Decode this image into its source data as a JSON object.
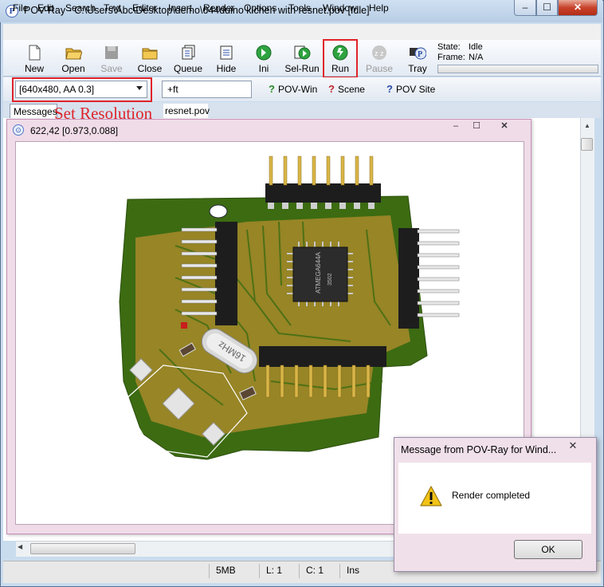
{
  "window": {
    "title": "POV-Ray - C:\\Users\\Abc\\Desktop\\demo\\644duino kichen with resnet.pov [Idle]",
    "app_icon_glyph": "P",
    "min_glyph": "–",
    "max_glyph": "☐",
    "close_glyph": "✕"
  },
  "menu": [
    "File",
    "Edit",
    "Search",
    "Text",
    "Editor",
    "Insert",
    "Render",
    "Options",
    "Tools",
    "Window",
    "Help"
  ],
  "toolbar": {
    "buttons": [
      {
        "label": "New",
        "icon": "new-file-icon",
        "enabled": true
      },
      {
        "label": "Open",
        "icon": "open-folder-icon",
        "enabled": true
      },
      {
        "label": "Save",
        "icon": "save-disk-icon",
        "enabled": false
      },
      {
        "label": "Close",
        "icon": "close-folder-icon",
        "enabled": true
      },
      {
        "label": "Queue",
        "icon": "queue-icon",
        "enabled": true
      },
      {
        "label": "Hide",
        "icon": "hide-icon",
        "enabled": true
      },
      {
        "label": "Ini",
        "icon": "ini-icon",
        "enabled": true
      },
      {
        "label": "Sel-Run",
        "icon": "sel-run-icon",
        "enabled": true
      },
      {
        "label": "Run",
        "icon": "run-icon",
        "enabled": true
      },
      {
        "label": "Pause",
        "icon": "pause-icon",
        "enabled": false
      },
      {
        "label": "Tray",
        "icon": "tray-icon",
        "enabled": true
      }
    ],
    "state_label": "State:",
    "state_value": "Idle",
    "frame_label": "Frame:",
    "frame_value": "N/A"
  },
  "toolbar2": {
    "resolution": "[640x480, AA 0.3]",
    "command_line": "+ft",
    "links": [
      {
        "label": "POV-Win",
        "icon": "help-green-icon",
        "color": "#2a8a2a"
      },
      {
        "label": "Scene",
        "icon": "help-red-icon",
        "color": "#c0282d"
      },
      {
        "label": "POV Site",
        "icon": "help-blue-icon",
        "color": "#2a4ea8"
      }
    ]
  },
  "tabs": {
    "messages": "Messages",
    "file": "resnet.pov"
  },
  "annotation": {
    "text": "Set Resolution",
    "color": "#e0232a"
  },
  "render_window": {
    "coords": "622,42 [0.973,0.088]",
    "min_glyph": "–",
    "max_glyph": "☐",
    "close_glyph": "✕",
    "chip_label": "ATMEGA644A",
    "chip_code": "3502",
    "crystal_label": "16MHz",
    "pcb_color": "#3c6b12",
    "trace_color": "#b89a2a"
  },
  "status_bar": {
    "memory": "5MB",
    "line": "L: 1",
    "column": "C: 1",
    "mode": "Ins"
  },
  "dialog": {
    "title": "Message from POV-Ray for Wind...",
    "close_glyph": "✕",
    "icon": "warning-icon",
    "message": "Render completed",
    "ok_label": "OK"
  }
}
